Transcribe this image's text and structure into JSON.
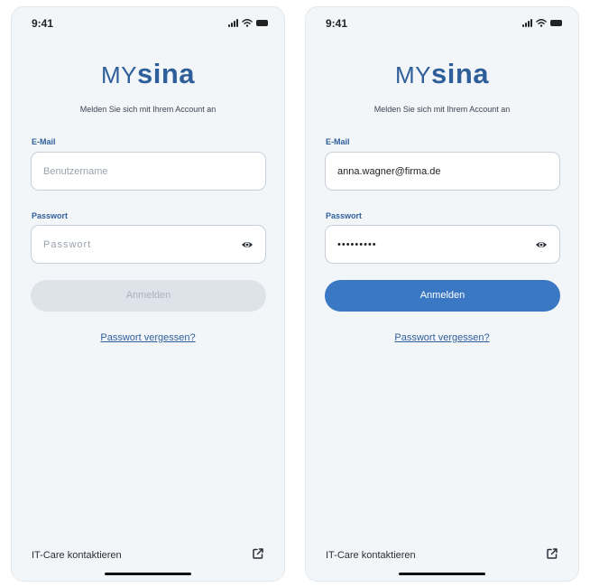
{
  "screens": [
    {
      "status_time": "9:41",
      "logo": {
        "my": "MY",
        "sina": "sina"
      },
      "subtitle": "Melden Sie sich mit Ihrem Account an",
      "email": {
        "label": "E-Mail",
        "value": "",
        "placeholder": "Benutzername"
      },
      "password": {
        "label": "Passwort",
        "value": "",
        "placeholder": "Passwort"
      },
      "login_button": {
        "label": "Anmelden",
        "state": "disabled"
      },
      "forgot_password": "Passwort vergessen?",
      "support": {
        "label": "IT-Care kontaktieren",
        "icon": "external-link-icon"
      }
    },
    {
      "status_time": "9:41",
      "logo": {
        "my": "MY",
        "sina": "sina"
      },
      "subtitle": "Melden Sie sich mit Ihrem Account an",
      "email": {
        "label": "E-Mail",
        "value": "anna.wagner@firma.de",
        "placeholder": "Benutzername"
      },
      "password": {
        "label": "Passwort",
        "value": "•••••••••",
        "placeholder": "Passwort"
      },
      "login_button": {
        "label": "Anmelden",
        "state": "enabled"
      },
      "forgot_password": "Passwort vergessen?",
      "support": {
        "label": "IT-Care kontaktieren",
        "icon": "external-link-icon"
      }
    }
  ],
  "colors": {
    "brand": "#2f5f9a",
    "button_active": "#3b78c4",
    "button_disabled": "#dde3e9",
    "screen_background": "#f3f6f9"
  }
}
